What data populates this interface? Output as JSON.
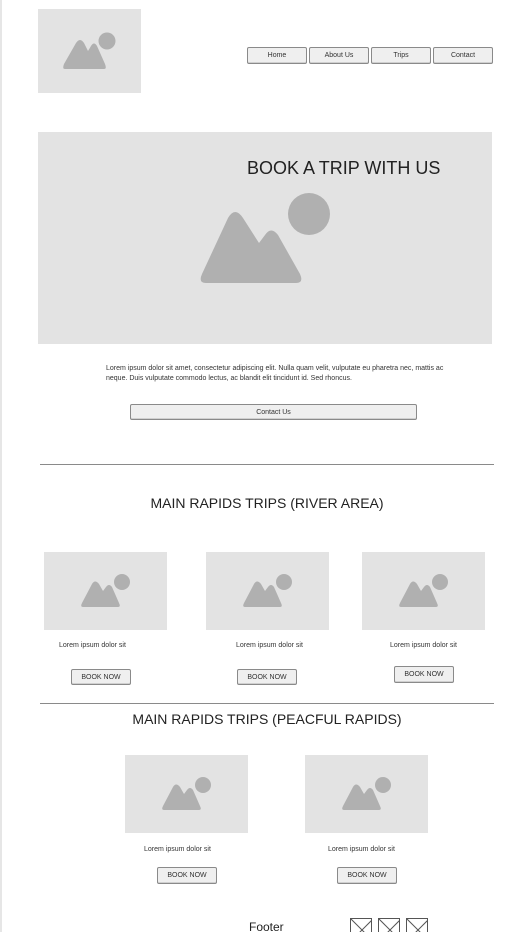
{
  "nav": {
    "items": [
      "Home",
      "About Us",
      "Trips",
      "Contact"
    ]
  },
  "hero": {
    "title": "BOOK A TRIP WITH US"
  },
  "intro": {
    "line1": "Lorem ipsum dolor sit amet, consectetur adipiscing elit. Nulla quam velit, vulputate eu pharetra nec, mattis ac",
    "line2": "neque. Duis vulputate commodo lectus, ac blandit elit tincidunt id. Sed rhoncus.",
    "contact_label": "Contact Us"
  },
  "section1": {
    "title": "MAIN RAPIDS TRIPS (RIVER AREA)",
    "cards": [
      {
        "caption": "Lorem ipsum dolor sit",
        "button": "BOOK NOW"
      },
      {
        "caption": "Lorem ipsum dolor sit",
        "button": "BOOK NOW"
      },
      {
        "caption": "Lorem ipsum dolor sit",
        "button": "BOOK NOW"
      }
    ]
  },
  "section2": {
    "title": "MAIN RAPIDS TRIPS (PEACFUL RAPIDS)",
    "cards": [
      {
        "caption": "Lorem ipsum dolor sit",
        "button": "BOOK NOW"
      },
      {
        "caption": "Lorem ipsum dolor sit",
        "button": "BOOK NOW"
      }
    ]
  },
  "footer": {
    "label": "Footer",
    "social_icons": [
      "placeholder-x-icon",
      "placeholder-x-icon",
      "placeholder-x-icon"
    ]
  },
  "colors": {
    "placeholder_bg": "#e3e3e3",
    "placeholder_icon": "#b0b0b0",
    "rule": "#8a8a8a"
  }
}
